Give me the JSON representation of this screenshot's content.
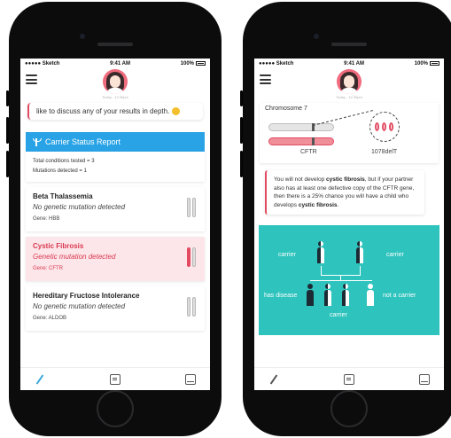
{
  "left_phone": {
    "status": {
      "carrier": "●●●●● Sketch",
      "time": "9:41 AM",
      "battery": "100%"
    },
    "timestamp": "Today - 12:35pm",
    "message": {
      "text": "like to discuss any of your results in depth."
    },
    "report": {
      "title": "Carrier Status Report",
      "total": "Total conditions tested = 3",
      "mutations": "Mutations detected = 1",
      "conditions": [
        {
          "name": "Beta Thalassemia",
          "result": "No genetic mutation detected",
          "gene": "Gene: HBB"
        },
        {
          "name": "Cystic Fibrosis",
          "result": "Genetic mutation detected",
          "gene": "Gene: CFTR"
        },
        {
          "name": "Hereditary Fructose Intolerance",
          "result": "No genetic mutation detected",
          "gene": "Gene: ALDOB"
        }
      ]
    }
  },
  "right_phone": {
    "status": {
      "carrier": "●●●●● Sketch",
      "time": "9:41 AM",
      "battery": "100%"
    },
    "timestamp": "Today - 12:35pm",
    "chromosome": {
      "title": "Chromosome 7",
      "gene_label": "CFTR",
      "variant_label": "1078delT"
    },
    "info": {
      "p1": "You will not develop ",
      "b1": "cystic fibrosis",
      "p2": ", but if your partner also has at least one defective copy of the CFTR gene, then there is a 25% chance you will have a child who develops ",
      "b2": "cystic fibrosis",
      "p3": "."
    },
    "inheritance": {
      "carrier_left": "carrier",
      "carrier_right": "carrier",
      "has_disease": "has disease",
      "not_carrier": "not a carrier",
      "carrier_bottom": "carrier"
    }
  },
  "colors": {
    "accent_blue": "#29a3e6",
    "alert_red": "#e24b62",
    "teal": "#2ec3bd"
  }
}
